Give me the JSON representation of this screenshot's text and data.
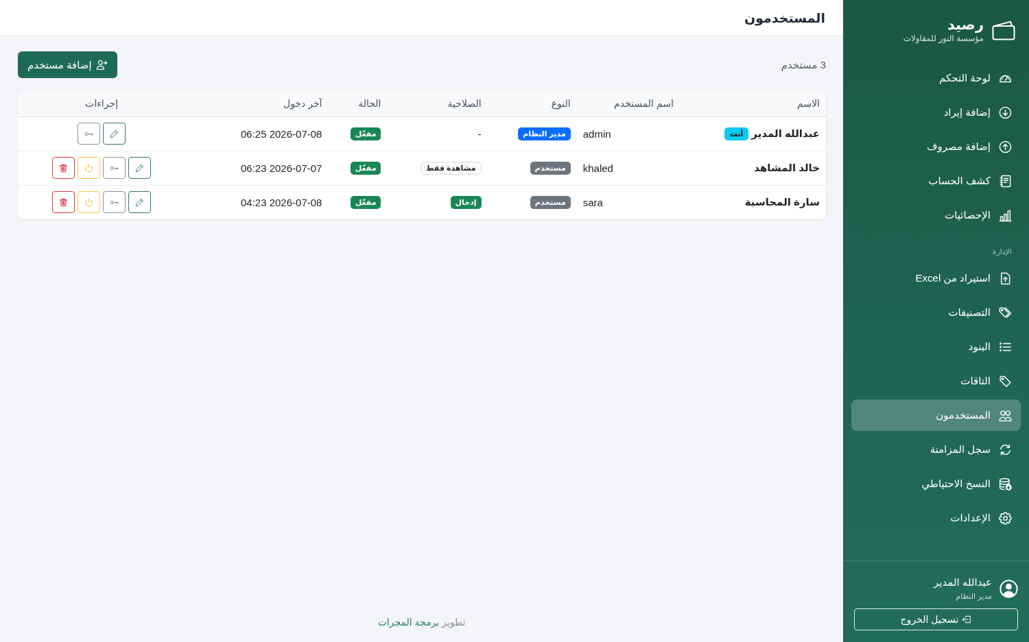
{
  "sidebar": {
    "brand": {
      "title": "رصيد",
      "subtitle": "مؤسسة النور للمقاولات"
    },
    "nav": [
      {
        "items": [
          {
            "label": "لوحة التحكم",
            "selected": false
          },
          {
            "label": "إضافة إيراد",
            "selected": false
          },
          {
            "label": "إضافة مصروف",
            "selected": false
          },
          {
            "label": "كشف الحساب",
            "selected": false
          },
          {
            "label": "الإحصائيات",
            "selected": false
          }
        ]
      },
      {
        "heading": "الإدارة",
        "items": [
          {
            "label": "استيراد من Excel",
            "selected": false
          },
          {
            "label": "التصنيفات",
            "selected": false
          },
          {
            "label": "البنود",
            "selected": false
          },
          {
            "label": "التاقات",
            "selected": false
          },
          {
            "label": "المستخدمون",
            "selected": true
          },
          {
            "label": "سجل المزامنة",
            "selected": false
          },
          {
            "label": "النسخ الاحتياطي",
            "selected": false
          },
          {
            "label": "الإعدادات",
            "selected": false
          }
        ]
      }
    ],
    "user": {
      "name": "عبدالله المدير",
      "role": "مدير النظام"
    },
    "logout": "تسجيل الخروج"
  },
  "header": {
    "title": "المستخدمون"
  },
  "toolbar": {
    "count": "3 مستخدم",
    "add_button": "إضافة مستخدم"
  },
  "table": {
    "columns": [
      "الاسم",
      "اسم المستخدم",
      "النوع",
      "الصلاحية",
      "الحالة",
      "آخر دخول",
      "إجراءات"
    ],
    "rows": [
      {
        "name": "عبدالله المدير",
        "badge": "أنت",
        "username": "admin",
        "type": {
          "text": "مدير النظام",
          "color": "#0d6efd"
        },
        "permission": {
          "kind": "plain",
          "text": "-"
        },
        "status": {
          "text": "مفعّل",
          "color": "#198754"
        },
        "last_login": "06:25 2026-07-08",
        "actions": [
          {
            "kind": "edit"
          },
          {
            "kind": "password"
          }
        ]
      },
      {
        "name": "خالد المشاهد",
        "username": "khaled",
        "type": {
          "text": "مستخدم",
          "color": "#6c757d"
        },
        "permission": {
          "kind": "badge",
          "text": "مشاهدة فقط",
          "color": "#f8f9fa"
        },
        "status": {
          "text": "مفعّل",
          "color": "#198754"
        },
        "last_login": "06:23 2026-07-07",
        "actions": [
          {
            "kind": "edit"
          },
          {
            "kind": "password"
          },
          {
            "kind": "toggle"
          },
          {
            "kind": "delete"
          }
        ]
      },
      {
        "name": "سارة المحاسبة",
        "username": "sara",
        "type": {
          "text": "مستخدم",
          "color": "#6c757d"
        },
        "permission": {
          "kind": "badge",
          "text": "إدخال",
          "color": "#198754"
        },
        "status": {
          "text": "مفعّل",
          "color": "#198754"
        },
        "last_login": "04:23 2026-07-08",
        "actions": [
          {
            "kind": "edit"
          },
          {
            "kind": "password"
          },
          {
            "kind": "toggle"
          },
          {
            "kind": "delete"
          }
        ]
      }
    ]
  },
  "footer": {
    "text": "تطوير",
    "link": "برمجة المجرات"
  }
}
